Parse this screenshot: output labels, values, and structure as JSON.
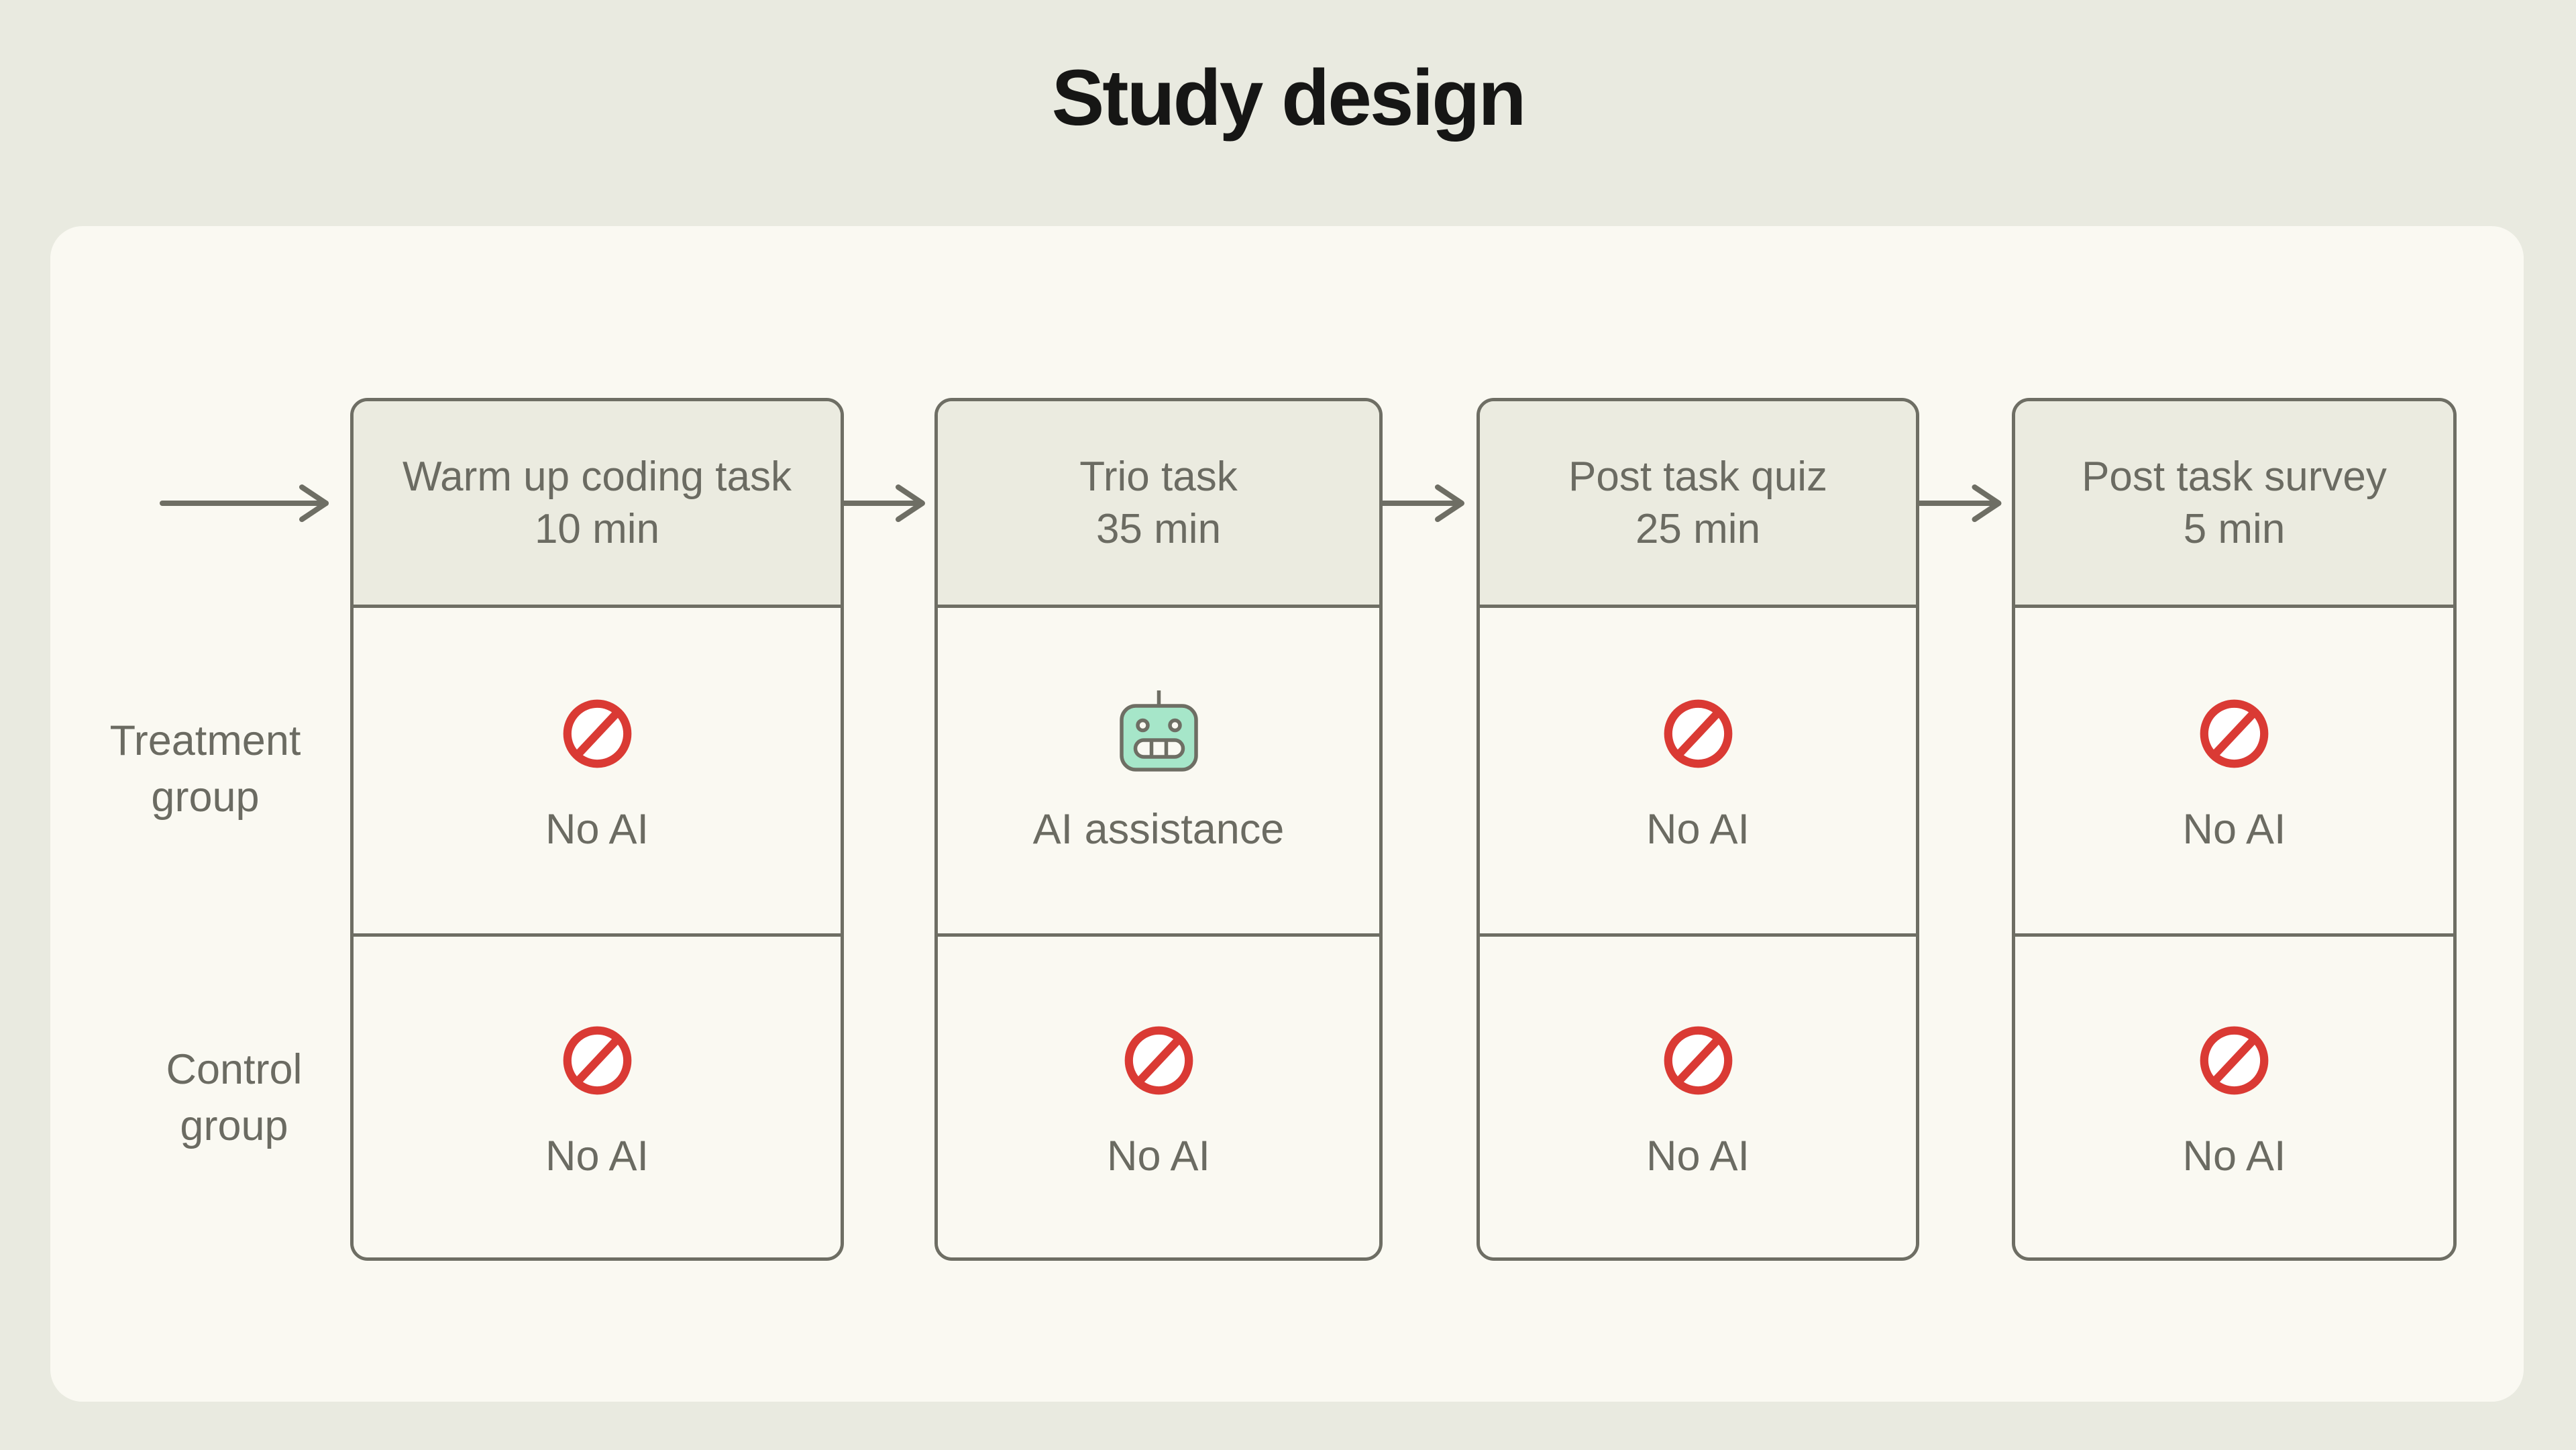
{
  "title": "Study design",
  "groups": [
    {
      "id": "treatment",
      "label": "Treatment\ngroup"
    },
    {
      "id": "control",
      "label": "Control\ngroup"
    }
  ],
  "stages": [
    {
      "title": "Warm up coding task",
      "duration": "10 min"
    },
    {
      "title": "Trio task",
      "duration": "35 min"
    },
    {
      "title": "Post task quiz",
      "duration": "25 min"
    },
    {
      "title": "Post task survey",
      "duration": "5 min"
    }
  ],
  "cells": {
    "treatment": [
      {
        "icon": "no-ai-icon",
        "label": "No AI"
      },
      {
        "icon": "robot-icon",
        "label": "AI assistance"
      },
      {
        "icon": "no-ai-icon",
        "label": "No AI"
      },
      {
        "icon": "no-ai-icon",
        "label": "No AI"
      }
    ],
    "control": [
      {
        "icon": "no-ai-icon",
        "label": "No AI"
      },
      {
        "icon": "no-ai-icon",
        "label": "No AI"
      },
      {
        "icon": "no-ai-icon",
        "label": "No AI"
      },
      {
        "icon": "no-ai-icon",
        "label": "No AI"
      }
    ]
  },
  "colors": {
    "page_background": "#E9EAE0",
    "card_background": "#FAF9F2",
    "header_fill": "#EBEBE0",
    "outline_gray": "#6E6E64",
    "text_gray": "#6B6B62",
    "title_black": "#161615",
    "no_ai_red": "#DA3A34",
    "robot_mint": "#A6E6C9"
  }
}
